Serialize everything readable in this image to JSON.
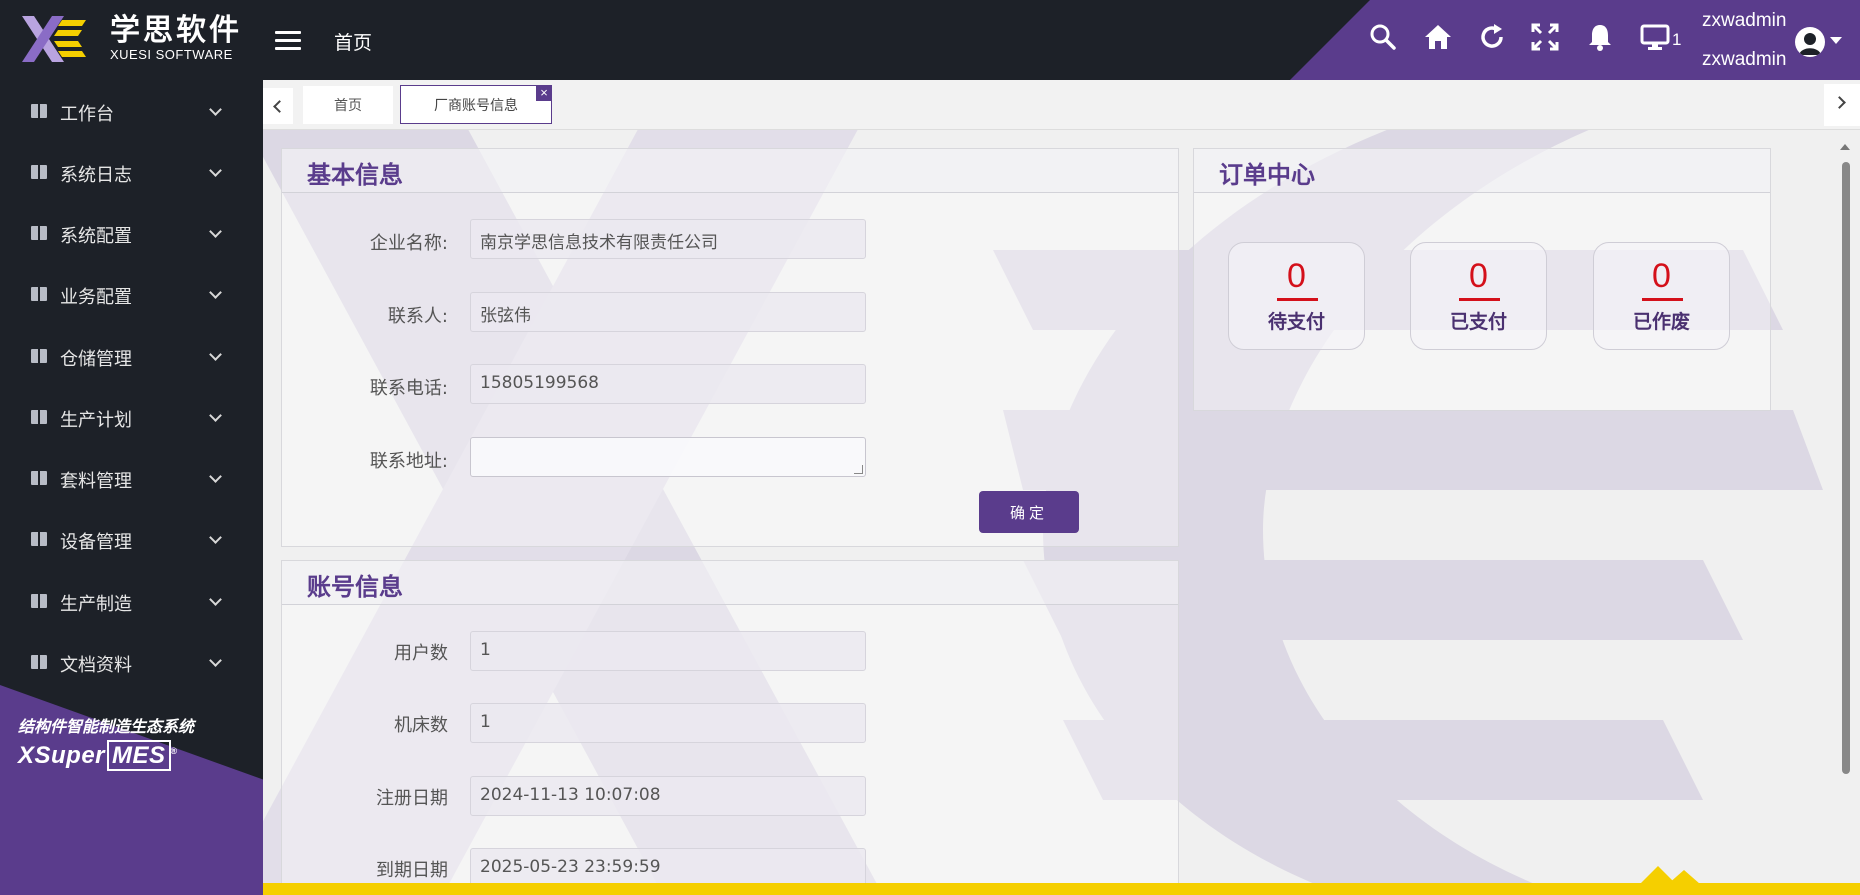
{
  "app": {
    "logo_cn": "学思软件",
    "logo_en": "XUESI SOFTWARE",
    "breadcrumb_home": "首页"
  },
  "header": {
    "screen_count": "1",
    "username_top": "zxwadmin",
    "username_bottom": "zxwadmin",
    "icons": [
      "search-icon",
      "home-icon",
      "refresh-icon",
      "fullscreen-icon",
      "bell-icon",
      "monitor-icon"
    ]
  },
  "sidebar": {
    "items": [
      {
        "label": "工作台"
      },
      {
        "label": "系统日志"
      },
      {
        "label": "系统配置"
      },
      {
        "label": "业务配置"
      },
      {
        "label": "仓储管理"
      },
      {
        "label": "生产计划"
      },
      {
        "label": "套料管理"
      },
      {
        "label": "设备管理"
      },
      {
        "label": "生产制造"
      },
      {
        "label": "文档资料"
      }
    ],
    "slogan": "结构件智能制造生态系统",
    "brand_prefix": "XSuper",
    "brand_mes": "MES",
    "brand_mark": "®"
  },
  "tabs": {
    "home": "首页",
    "active": "厂商账号信息",
    "close": "×"
  },
  "basic_info": {
    "title": "基本信息",
    "company_label": "企业名称:",
    "company_value": "南京学思信息技术有限责任公司",
    "contact_label": "联系人:",
    "contact_value": "张弦伟",
    "phone_label": "联系电话:",
    "phone_value": "15805199568",
    "address_label": "联系地址:",
    "address_value": "",
    "confirm_button": "确定"
  },
  "account_info": {
    "title": "账号信息",
    "users_label": "用户数",
    "users_value": "1",
    "machines_label": "机床数",
    "machines_value": "1",
    "register_label": "注册日期",
    "register_value": "2024-11-13 10:07:08",
    "expire_label": "到期日期",
    "expire_value": "2025-05-23 23:59:59"
  },
  "order_center": {
    "title": "订单中心",
    "boxes": [
      {
        "count": "0",
        "label": "待支付"
      },
      {
        "count": "0",
        "label": "已支付"
      },
      {
        "count": "0",
        "label": "已作废"
      }
    ]
  },
  "colors": {
    "accent": "#5a3c8c",
    "dark": "#1d2128",
    "count_red": "#d4101a",
    "bottom_yellow": "#f5cf00"
  }
}
